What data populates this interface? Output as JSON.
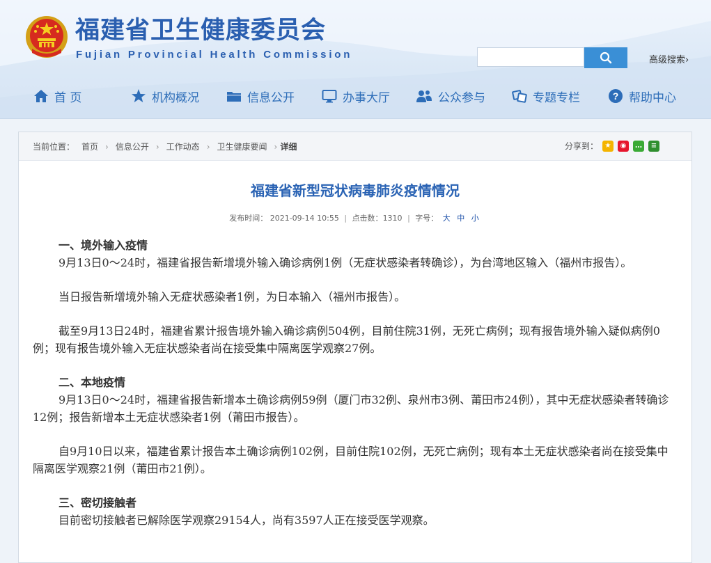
{
  "site": {
    "title": "福建省卫生健康委员会",
    "subtitle": "Fujian Provincial Health Commission"
  },
  "search": {
    "value": "",
    "placeholder": "",
    "advanced_label": "高级搜索"
  },
  "nav": {
    "items": [
      {
        "label": "首 页",
        "icon": "home-icon"
      },
      {
        "label": "机构概况",
        "icon": "star-icon"
      },
      {
        "label": "信息公开",
        "icon": "folder-icon"
      },
      {
        "label": "办事大厅",
        "icon": "monitor-icon"
      },
      {
        "label": "公众参与",
        "icon": "people-icon"
      },
      {
        "label": "专题专栏",
        "icon": "cubes-icon"
      },
      {
        "label": "帮助中心",
        "icon": "help-icon"
      }
    ]
  },
  "breadcrumb": {
    "prefix": "当前位置：",
    "items": [
      "首页",
      "信息公开",
      "工作动态",
      "卫生健康要闻"
    ],
    "current": "详细"
  },
  "share": {
    "label": "分享到：",
    "targets": [
      {
        "icon": "qzone-icon",
        "color": "#f4b400"
      },
      {
        "icon": "weibo-icon",
        "color": "#e6162d"
      },
      {
        "icon": "wechat-icon",
        "color": "#3aaa35"
      },
      {
        "icon": "douban-icon",
        "color": "#2f8f2f"
      }
    ]
  },
  "article": {
    "title": "福建省新型冠状病毒肺炎疫情情况",
    "meta": {
      "publish_label": "发布时间：",
      "publish_time": "2021-09-14 10:55",
      "clicks_label": "点击数：",
      "clicks": "1310",
      "font_label": "字号：",
      "size_large": "大",
      "size_medium": "中",
      "size_small": "小"
    },
    "sections": [
      {
        "heading": "一、境外输入疫情",
        "paragraphs": [
          "9月13日0～24时，福建省报告新增境外输入确诊病例1例（无症状感染者转确诊），为台湾地区输入（福州市报告）。",
          "当日报告新增境外输入无症状感染者1例，为日本输入（福州市报告）。",
          "截至9月13日24时，福建省累计报告境外输入确诊病例504例，目前住院31例，无死亡病例；现有报告境外输入疑似病例0例；现有报告境外输入无症状感染者尚在接受集中隔离医学观察27例。"
        ]
      },
      {
        "heading": "二、本地疫情",
        "paragraphs": [
          "9月13日0～24时，福建省报告新增本土确诊病例59例（厦门市32例、泉州市3例、莆田市24例），其中无症状感染者转确诊12例；报告新增本土无症状感染者1例（莆田市报告）。",
          "自9月10日以来，福建省累计报告本土确诊病例102例，目前住院102例，无死亡病例；现有本土无症状感染者尚在接受集中隔离医学观察21例（莆田市21例）。"
        ]
      },
      {
        "heading": "三、密切接触者",
        "paragraphs": [
          "目前密切接触者已解除医学观察29154人，尚有3597人正在接受医学观察。"
        ]
      }
    ]
  }
}
